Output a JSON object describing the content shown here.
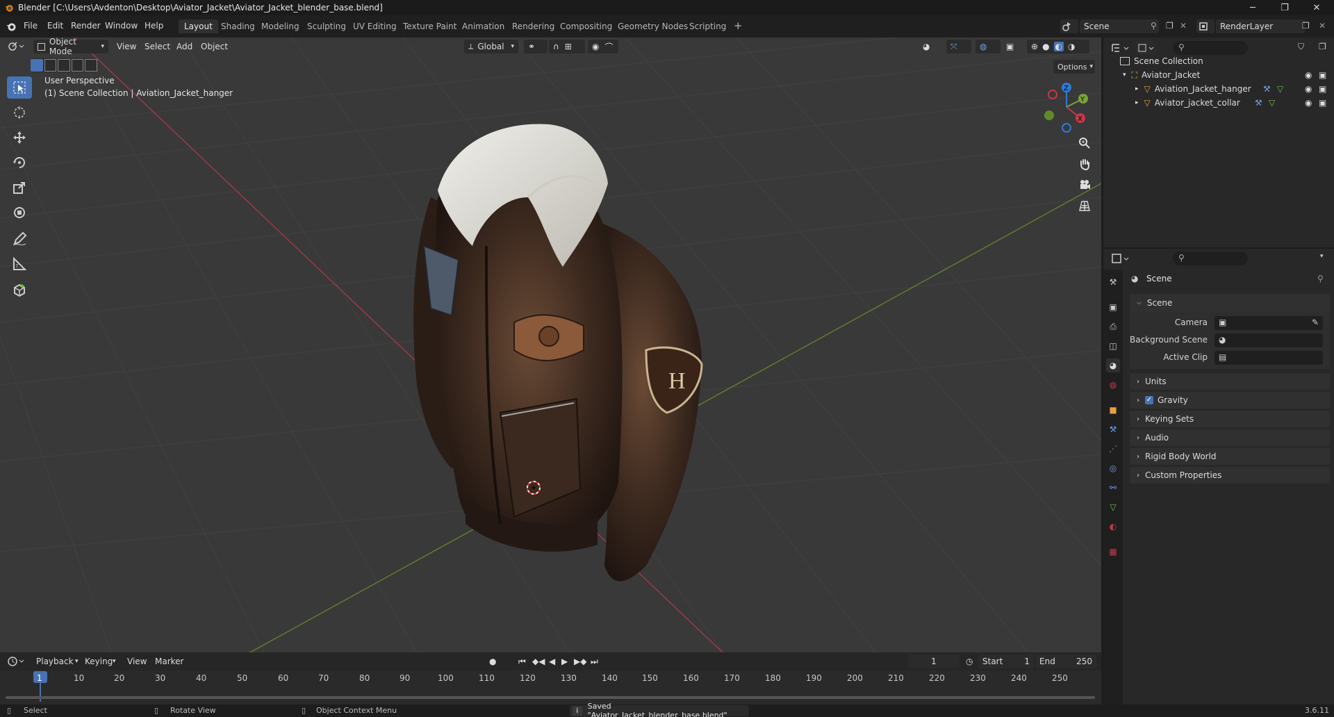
{
  "window": {
    "title": "Blender [C:\\Users\\Avdenton\\Desktop\\Aviator_Jacket\\Aviator_Jacket_blender_base.blend]",
    "minimize": "─",
    "maximize": "❐",
    "close": "✕"
  },
  "menu": [
    "File",
    "Edit",
    "Render",
    "Window",
    "Help"
  ],
  "workspaces": [
    "Layout",
    "Shading",
    "Modeling",
    "Sculpting",
    "UV Editing",
    "Texture Paint",
    "Animation",
    "Rendering",
    "Compositing",
    "Geometry Nodes",
    "Scripting"
  ],
  "workspace_add": "+",
  "scene_field": "Scene",
  "view_layer_field": "RenderLayer",
  "viewport": {
    "mode": "Object Mode",
    "menus": [
      "View",
      "Select",
      "Add",
      "Object"
    ],
    "transform_orientation": "Global",
    "options": "Options",
    "overlay_title": "User Perspective",
    "overlay_subtitle": "(1) Scene Collection | Aviation_Jacket_hanger",
    "gizmo_axes": {
      "z": "Z",
      "y": "Y",
      "x": "X"
    }
  },
  "timeline": {
    "menus": [
      "Playback",
      "Keying",
      "View",
      "Marker"
    ],
    "current_frame": "1",
    "start_label": "Start",
    "start": "1",
    "end_label": "End",
    "end": "250",
    "ruler": [
      "1",
      "10",
      "20",
      "30",
      "40",
      "50",
      "60",
      "70",
      "80",
      "90",
      "100",
      "110",
      "120",
      "130",
      "140",
      "150",
      "160",
      "170",
      "180",
      "190",
      "200",
      "210",
      "220",
      "230",
      "240",
      "250"
    ]
  },
  "statusbar": {
    "select": "Select",
    "rotate": "Rotate View",
    "context": "Object Context Menu",
    "message": "Saved \"Aviator_Jacket_blender_base.blend\"",
    "version": "3.6.11"
  },
  "outliner": {
    "root": "Scene Collection",
    "items": [
      {
        "label": "Aviator_Jacket",
        "level": 1
      },
      {
        "label": "Aviation_Jacket_hanger",
        "level": 2
      },
      {
        "label": "Aviator_jacket_collar",
        "level": 2
      }
    ]
  },
  "properties": {
    "context": "Scene",
    "section": "Scene",
    "fields": [
      "Camera",
      "Background Scene",
      "Active Clip"
    ],
    "panels": [
      "Units",
      "Gravity",
      "Keying Sets",
      "Audio",
      "Rigid Body World",
      "Custom Properties"
    ],
    "gravity_checked": true
  },
  "colors": {
    "accent": "#4772b3",
    "x_axis": "#c4384a",
    "y_axis": "#7aa336",
    "z_axis": "#2f7bd6"
  }
}
